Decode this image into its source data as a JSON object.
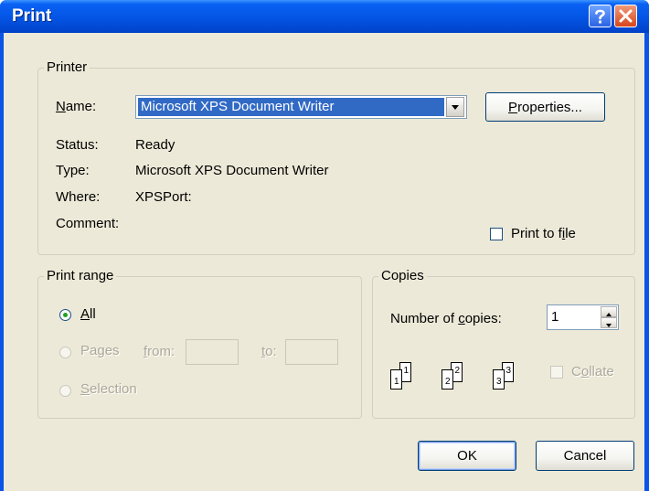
{
  "window": {
    "title": "Print"
  },
  "printer": {
    "group_label": "Printer",
    "name_label": "Name:",
    "name_value": "Microsoft XPS Document Writer",
    "properties_label": "Properties...",
    "status_label": "Status:",
    "status_value": "Ready",
    "type_label": "Type:",
    "type_value": "Microsoft XPS Document Writer",
    "where_label": "Where:",
    "where_value": "XPSPort:",
    "comment_label": "Comment:",
    "print_to_file_label": "Print to file",
    "print_to_file_checked": false
  },
  "print_range": {
    "group_label": "Print range",
    "all_label": "All",
    "pages_label": "Pages",
    "from_label": "from:",
    "to_label": "to:",
    "from_value": "",
    "to_value": "",
    "selection_label": "Selection",
    "selected": "All"
  },
  "copies": {
    "group_label": "Copies",
    "number_label": "Number of copies:",
    "number_value": "1",
    "collate_label": "Collate",
    "collate_checked": false,
    "collate_pages": [
      "1",
      "1",
      "2",
      "2",
      "3",
      "3"
    ]
  },
  "buttons": {
    "ok_label": "OK",
    "cancel_label": "Cancel"
  },
  "colors": {
    "titlebar": "#0454e4",
    "dialog_bg": "#ece9d8",
    "selection": "#316ac5",
    "disabled_text": "#aca899"
  },
  "icons": {
    "help": "question-mark",
    "close": "x-mark",
    "dropdown": "down-triangle",
    "spin_up": "up-triangle",
    "spin_down": "down-triangle"
  }
}
